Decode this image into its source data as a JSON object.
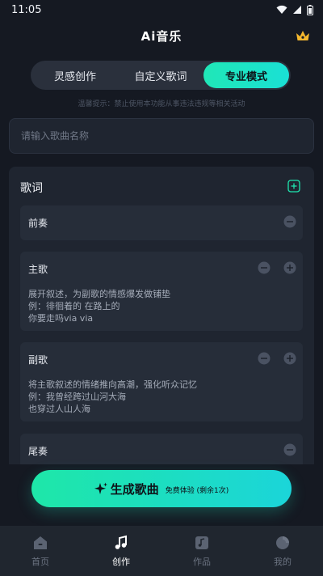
{
  "status_bar": {
    "time": "11:05"
  },
  "header": {
    "title": "Ai音乐"
  },
  "mode_tabs": [
    {
      "label": "灵感创作",
      "active": false
    },
    {
      "label": "自定义歌词",
      "active": false
    },
    {
      "label": "专业模式",
      "active": true
    }
  ],
  "notice": "温馨提示：禁止使用本功能从事违法违规等相关活动",
  "song_title_input": {
    "value": "",
    "placeholder": "请输入歌曲名称"
  },
  "lyrics": {
    "title": "歌词",
    "sections": [
      {
        "label": "前奏",
        "lines": []
      },
      {
        "label": "主歌",
        "lines": [
          "展开叙述，为副歌的情感爆发做铺垫",
          "例：徘徊着的 在路上的",
          "你要走吗via via"
        ]
      },
      {
        "label": "副歌",
        "lines": [
          "将主歌叙述的情绪推向高潮，强化听众记忆",
          "例：我曾经跨过山河大海",
          "也穿过人山人海"
        ]
      },
      {
        "label": "尾奏",
        "lines": []
      }
    ]
  },
  "generate": {
    "label": "生成歌曲",
    "sub": "免费体验 (剩余1次)"
  },
  "bottom_nav": [
    {
      "label": "首页",
      "icon": "home-icon",
      "active": false
    },
    {
      "label": "创作",
      "icon": "music-note-icon",
      "active": true
    },
    {
      "label": "作品",
      "icon": "music-album-icon",
      "active": false
    },
    {
      "label": "我的",
      "icon": "profile-icon",
      "active": false
    }
  ],
  "colors": {
    "accent": "#1ee7b0",
    "background": "#151922",
    "card": "#1f2530",
    "section": "#262d39"
  }
}
